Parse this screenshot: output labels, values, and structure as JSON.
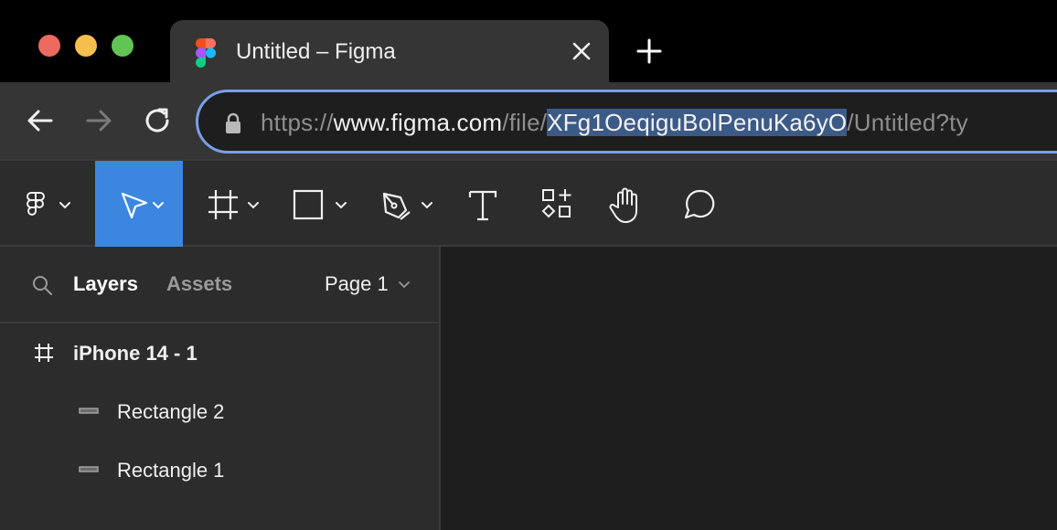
{
  "browser": {
    "tab": {
      "title": "Untitled – Figma",
      "favicon": "figma-logo-icon"
    },
    "url": {
      "prefix_dim": "https://",
      "host": "www.figma.com",
      "path_dim": "/file/",
      "selected": "XFg1OeqiguBolPenuKa6yO",
      "rest": "/Untitled?ty"
    },
    "nav": {
      "back": "arrow-left-icon",
      "forward": "arrow-right-icon",
      "reload": "reload-icon"
    }
  },
  "toolbar": {
    "tools": [
      "figma-menu-icon",
      "move-tool-icon",
      "frame-tool-icon",
      "rectangle-tool-icon",
      "pen-tool-icon",
      "text-tool-icon",
      "components-icon",
      "hand-tool-icon",
      "comment-tool-icon"
    ],
    "active_color": "#3c86e0"
  },
  "panel": {
    "tabs": {
      "layers": "Layers",
      "assets": "Assets"
    },
    "page": "Page 1",
    "layers": [
      {
        "name": "iPhone 14 - 1",
        "type": "frame"
      },
      {
        "name": "Rectangle 2",
        "type": "rectangle"
      },
      {
        "name": "Rectangle 1",
        "type": "rectangle"
      }
    ]
  }
}
